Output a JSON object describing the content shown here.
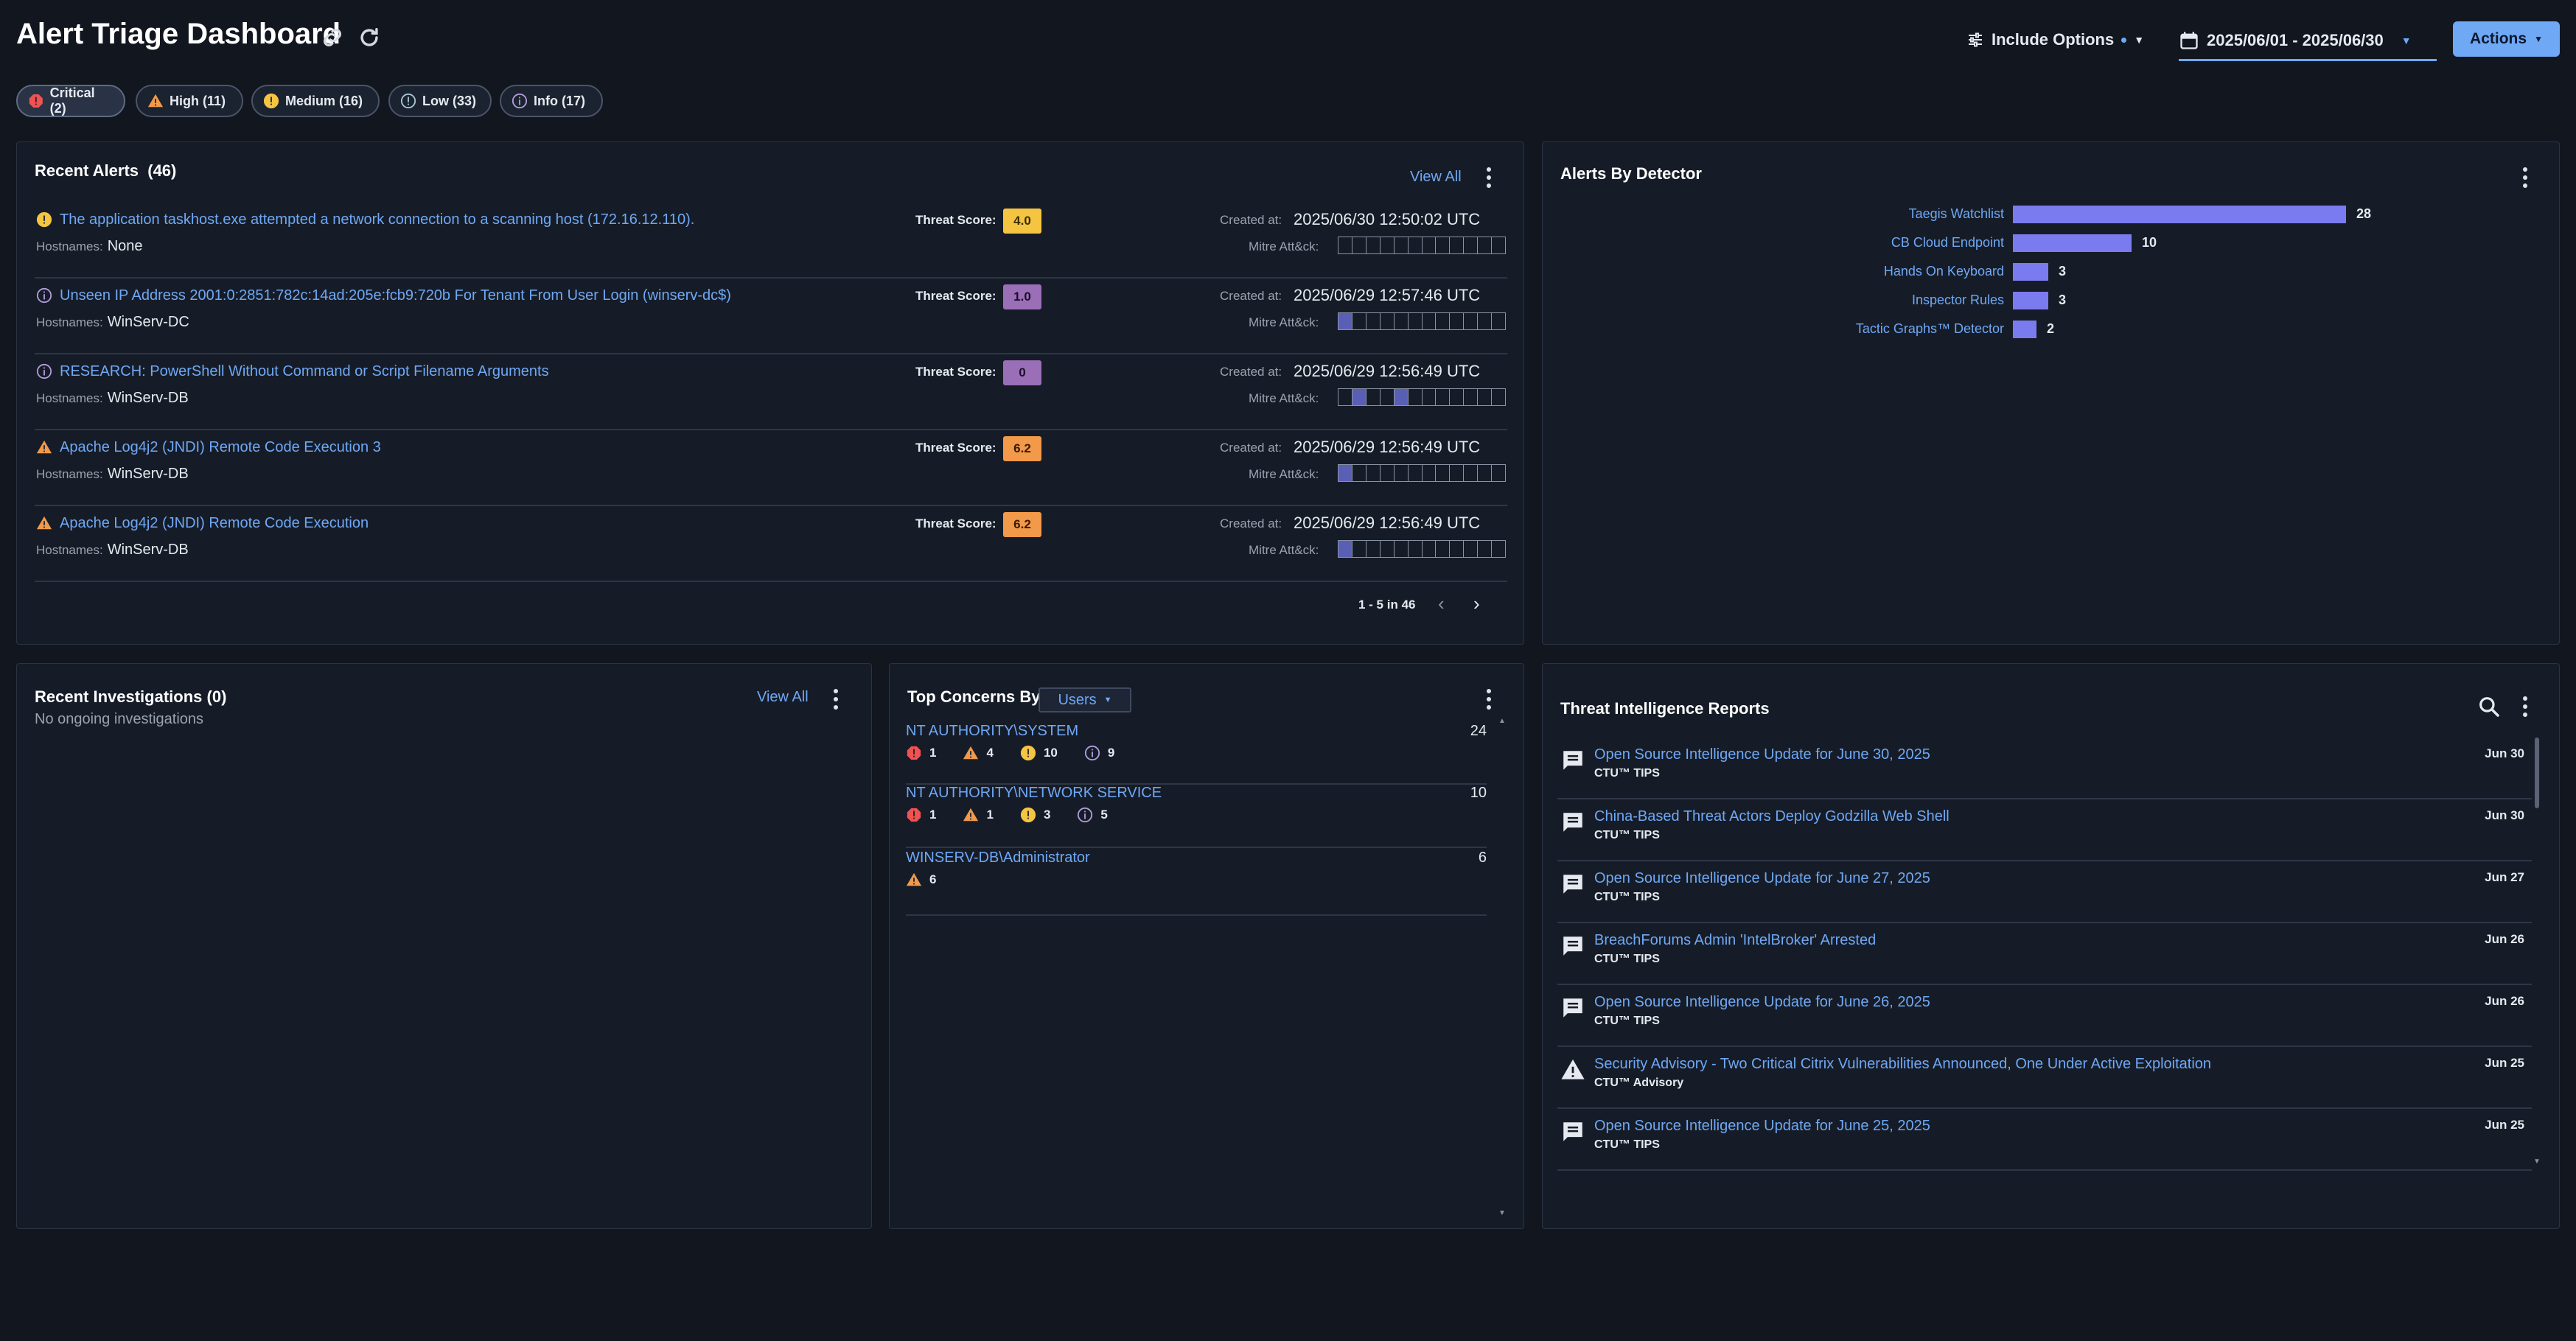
{
  "header": {
    "title": "Alert Triage Dashboard",
    "include_options": "Include Options",
    "date_range": "2025/06/01 - 2025/06/30",
    "actions": "Actions"
  },
  "severity_chips": [
    {
      "label": "Critical (2)",
      "color": "#f05252"
    },
    {
      "label": "High (11)",
      "color": "#f2994a"
    },
    {
      "label": "Medium (16)",
      "color": "#f5c542"
    },
    {
      "label": "Low (33)",
      "color": "#a8c8d8"
    },
    {
      "label": "Info (17)",
      "color": "#b39ddb"
    }
  ],
  "recent_alerts": {
    "title": "Recent Alerts",
    "count": "(46)",
    "view_all": "View All",
    "threat_score_label": "Threat Score:",
    "created_label": "Created at:",
    "mitre_label": "Mitre Att&ck:",
    "hostnames_label": "Hostnames:",
    "pagination": "1 - 5 in 46",
    "items": [
      {
        "title": "The application taskhost.exe attempted a network connection to a scanning host (172.16.12.110).",
        "hostnames": "None",
        "score": "4.0",
        "score_color": "#f5c542",
        "created": "2025/06/30 12:50:02 UTC",
        "severity": "medium"
      },
      {
        "title": "Unseen IP Address 2001:0:2851:782c:14ad:205e:fcb9:720b For Tenant From User Login (winserv-dc$)",
        "hostnames": "WinServ-DC",
        "score": "1.0",
        "score_color": "#9b6fb8",
        "created": "2025/06/29 12:57:46 UTC",
        "severity": "info"
      },
      {
        "title": "RESEARCH: PowerShell Without Command or Script Filename Arguments",
        "hostnames": "WinServ-DB",
        "score": "0",
        "score_color": "#9b6fb8",
        "created": "2025/06/29 12:56:49 UTC",
        "severity": "info"
      },
      {
        "title": "Apache Log4j2 (JNDI) Remote Code Execution 3",
        "hostnames": "WinServ-DB",
        "score": "6.2",
        "score_color": "#f2994a",
        "created": "2025/06/29 12:56:49 UTC",
        "severity": "high"
      },
      {
        "title": "Apache Log4j2 (JNDI) Remote Code Execution",
        "hostnames": "WinServ-DB",
        "score": "6.2",
        "score_color": "#f2994a",
        "created": "2025/06/29 12:56:49 UTC",
        "severity": "high"
      }
    ]
  },
  "alerts_by_detector": {
    "title": "Alerts By Detector",
    "chart_data": {
      "type": "bar",
      "orientation": "horizontal",
      "categories": [
        "Taegis Watchlist",
        "CB Cloud Endpoint",
        "Hands On Keyboard",
        "Inspector Rules",
        "Tactic Graphs™ Detector"
      ],
      "values": [
        28,
        10,
        3,
        3,
        2
      ],
      "color": "#7b7bf0"
    }
  },
  "recent_investigations": {
    "title": "Recent Investigations (0)",
    "view_all": "View All",
    "empty_text": "No ongoing investigations"
  },
  "top_concerns": {
    "title": "Top Concerns By",
    "selector": "Users",
    "items": [
      {
        "name": "NT AUTHORITY\\SYSTEM",
        "total": "24",
        "critical": "1",
        "high": "4",
        "medium": "10",
        "info": "9"
      },
      {
        "name": "NT AUTHORITY\\NETWORK SERVICE",
        "total": "10",
        "critical": "1",
        "high": "1",
        "medium": "3",
        "info": "5"
      },
      {
        "name": "WINSERV-DB\\Administrator",
        "total": "6",
        "high": "6"
      }
    ]
  },
  "threat_reports": {
    "title": "Threat Intelligence Reports",
    "items": [
      {
        "title": "Open Source Intelligence Update for June 30, 2025",
        "source": "CTU™ TIPS",
        "date": "Jun 30",
        "icon": "comment-icon"
      },
      {
        "title": "China-Based Threat Actors Deploy Godzilla Web Shell",
        "source": "CTU™ TIPS",
        "date": "Jun 30",
        "icon": "comment-icon"
      },
      {
        "title": "Open Source Intelligence Update for June 27, 2025",
        "source": "CTU™ TIPS",
        "date": "Jun 27",
        "icon": "comment-icon"
      },
      {
        "title": "BreachForums Admin 'IntelBroker' Arrested",
        "source": "CTU™ TIPS",
        "date": "Jun 26",
        "icon": "comment-icon"
      },
      {
        "title": "Open Source Intelligence Update for June 26, 2025",
        "source": "CTU™ TIPS",
        "date": "Jun 26",
        "icon": "comment-icon"
      },
      {
        "title": "Security Advisory - Two Critical Citrix Vulnerabilities Announced, One Under Active Exploitation",
        "source": "CTU™ Advisory",
        "date": "Jun 25",
        "icon": "warning-icon"
      },
      {
        "title": "Open Source Intelligence Update for June 25, 2025",
        "source": "CTU™ TIPS",
        "date": "Jun 25",
        "icon": "comment-icon"
      }
    ]
  }
}
